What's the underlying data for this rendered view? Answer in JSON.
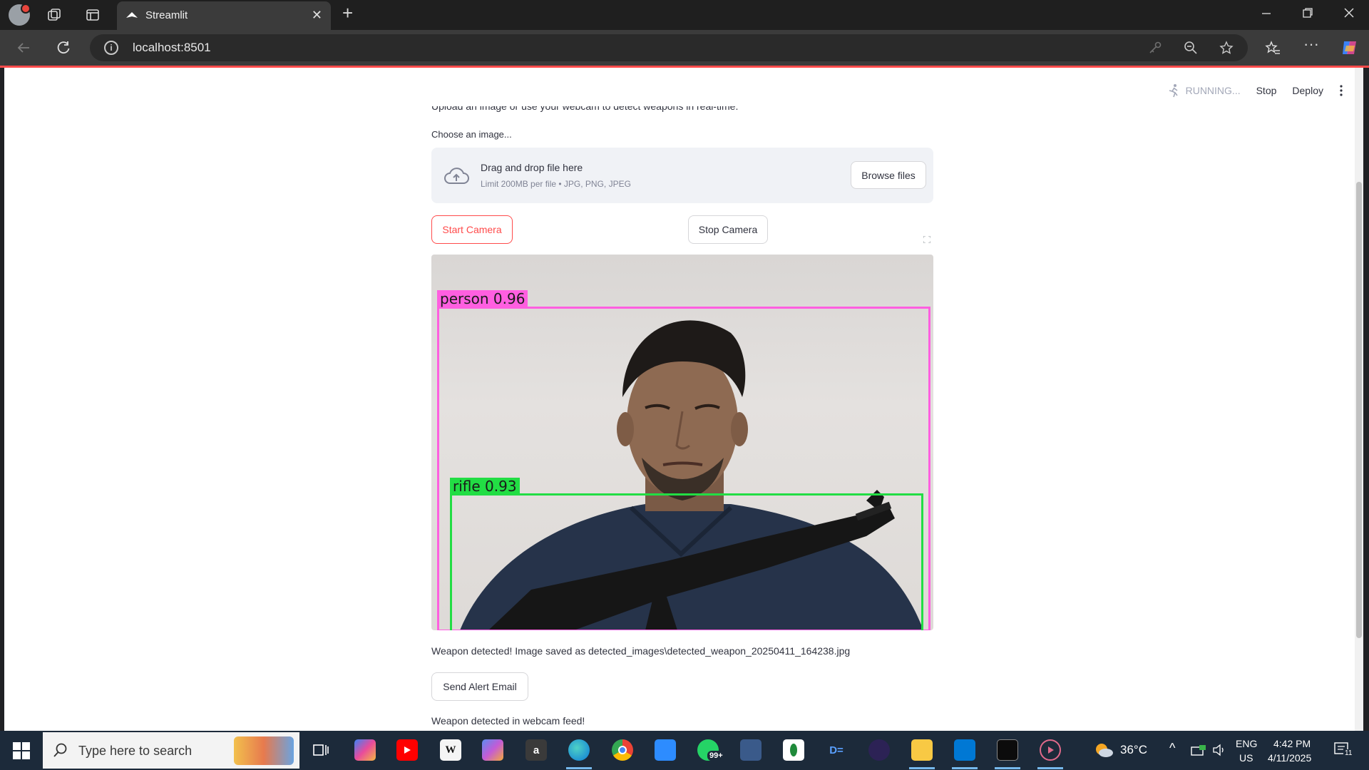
{
  "browser": {
    "tab_title": "Streamlit",
    "url": "localhost:8501",
    "new_tab_symbol": "+",
    "close_tab_symbol": "✕"
  },
  "streamlit_header": {
    "status": "RUNNING...",
    "stop_label": "Stop",
    "deploy_label": "Deploy"
  },
  "app": {
    "intro_cut": "Upload an image or use your webcam to detect weapons in real-time.",
    "uploader_label": "Choose an image...",
    "dropzone_title": "Drag and drop file here",
    "dropzone_limit": "Limit 200MB per file • JPG, PNG, JPEG",
    "browse_label": "Browse files",
    "start_camera_label": "Start Camera",
    "stop_camera_label": "Stop Camera",
    "detections": [
      {
        "label": "person 0.96",
        "color": "#ff5fe0"
      },
      {
        "label": "rifle 0.93",
        "color": "#22dd44"
      }
    ],
    "saved_message": "Weapon detected! Image saved as detected_images\\detected_weapon_20250411_164238.jpg",
    "alert_button_label": "Send Alert Email",
    "webcam_message": "Weapon detected in webcam feed!"
  },
  "taskbar": {
    "search_placeholder": "Type here to search",
    "badge_count": "99+",
    "weather": "36°C",
    "lang_top": "ENG",
    "lang_bottom": "US",
    "time": "4:42 PM",
    "date": "4/11/2025",
    "notification_count": "11"
  },
  "colors": {
    "streamlit_red": "#ff4b4b",
    "person_box": "#ff5fe0",
    "rifle_box": "#22dd44"
  }
}
